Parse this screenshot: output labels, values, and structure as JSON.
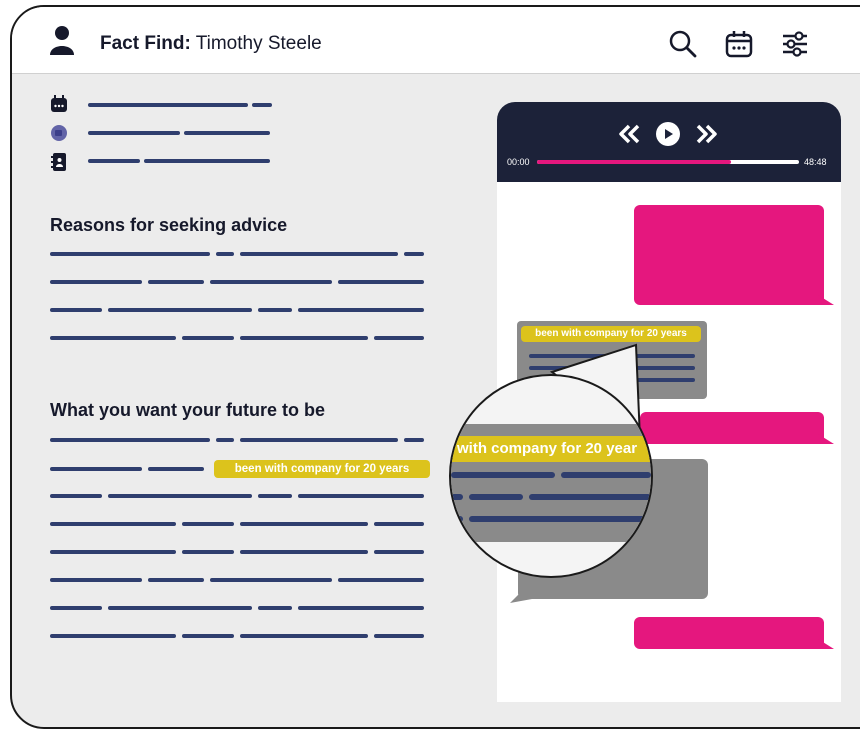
{
  "header": {
    "title_bold": "Fact Find:",
    "title_name": " Timothy Steele",
    "icons": [
      "user-icon",
      "search-icon",
      "calendar-icon",
      "filter-icon"
    ]
  },
  "meta_icons": [
    "calendar-icon",
    "teams-icon",
    "contact-book-icon"
  ],
  "sections": {
    "reasons_heading": "Reasons for seeking advice",
    "future_heading": "What you want your future to be"
  },
  "highlight_text": "been with company for 20 years",
  "lens_highlight_text": "with company for 20 year",
  "player": {
    "time_current": "00:00",
    "time_total": "48:48",
    "progress": 0.74,
    "controls": [
      "rewind-icon",
      "play-icon",
      "fast-forward-icon"
    ]
  },
  "colors": {
    "navy": "#1c2239",
    "line": "#2f3e6e",
    "pink": "#e5177e",
    "highlight": "#dcc31c",
    "grey_bubble": "#8a8a8a",
    "background": "#ececec"
  }
}
